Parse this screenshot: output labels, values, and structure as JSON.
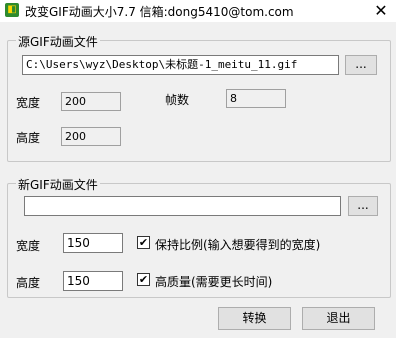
{
  "window": {
    "title": "改变GIF动画大小7.7  信箱:dong5410@tom.com",
    "icon": "app-icon",
    "close_glyph": "✕"
  },
  "source_group": {
    "legend": "源GIF动画文件",
    "file_path": "C:\\Users\\wyz\\Desktop\\未标题-1_meitu_11.gif",
    "browse_label": "...",
    "width_label": "宽度",
    "width_value": "200",
    "frames_label": "帧数",
    "frames_value": "8",
    "height_label": "高度",
    "height_value": "200"
  },
  "new_group": {
    "legend": "新GIF动画文件",
    "file_path": "",
    "browse_label": "...",
    "width_label": "宽度",
    "width_value": "150",
    "keep_ratio_label": "保持比例(输入想要得到的宽度)",
    "keep_ratio_checked": true,
    "height_label": "高度",
    "height_value": "150",
    "high_quality_label": "高质量(需要更长时间)",
    "high_quality_checked": true
  },
  "buttons": {
    "convert_label": "转换",
    "exit_label": "退出"
  },
  "check_glyph": "✔"
}
